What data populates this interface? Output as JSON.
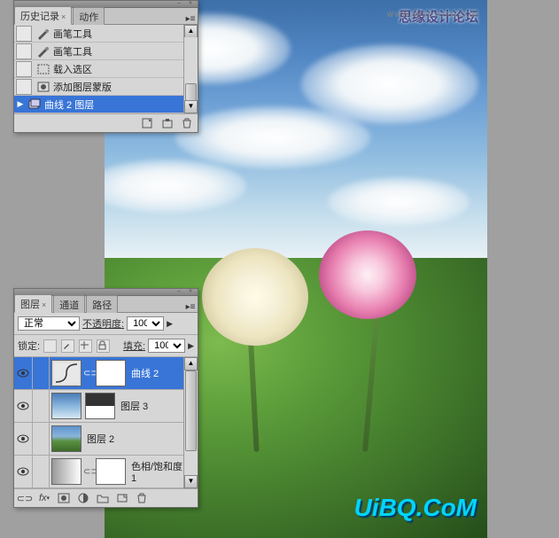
{
  "watermark": {
    "text1": "思缘设计论坛",
    "text2": "WWW.MISSYUAN.COM",
    "logo": "UiBQ.CoM"
  },
  "history": {
    "tabs": [
      {
        "label": "历史记录",
        "active": true
      },
      {
        "label": "动作",
        "active": false
      }
    ],
    "items": [
      {
        "label": "画笔工具",
        "icon": "brush"
      },
      {
        "label": "画笔工具",
        "icon": "brush"
      },
      {
        "label": "载入选区",
        "icon": "selection"
      },
      {
        "label": "添加图层蒙版",
        "icon": "mask"
      },
      {
        "label": "曲线 2 图层",
        "icon": "layer",
        "selected": true,
        "marker": "▶"
      }
    ]
  },
  "layers": {
    "tabs": [
      {
        "label": "图层",
        "active": true
      },
      {
        "label": "通道",
        "active": false
      },
      {
        "label": "路径",
        "active": false
      }
    ],
    "blend_mode": "正常",
    "opacity_label": "不透明度:",
    "opacity": "100%",
    "lock_label": "锁定:",
    "fill_label": "填充:",
    "fill": "100%",
    "items": [
      {
        "name": "曲线 2",
        "selected": true,
        "thumb": "curve",
        "mask": true,
        "link": true
      },
      {
        "name": "图层 3",
        "thumb": "sky",
        "mask": "bw"
      },
      {
        "name": "图层 2",
        "thumb": "img"
      },
      {
        "name": "色相/饱和度 1",
        "thumb": "hue",
        "mask": true
      }
    ]
  }
}
